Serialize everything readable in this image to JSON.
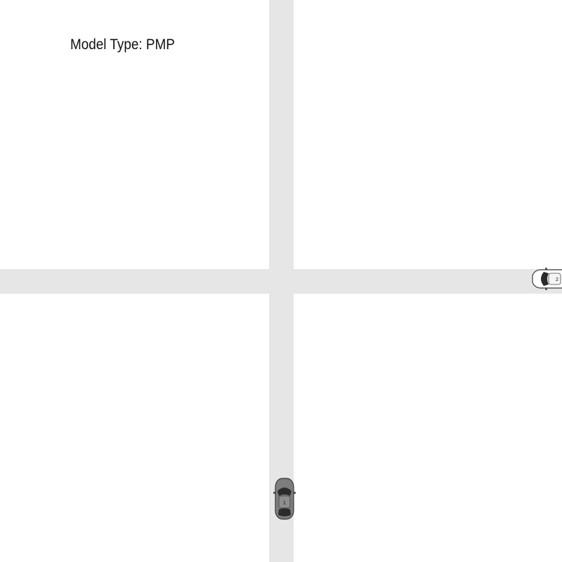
{
  "scene": {
    "model_type_label": "Model Type: PMP",
    "road_color": "#e6e6e6",
    "background_color": "#ffffff"
  },
  "vehicles": [
    {
      "id": "1",
      "label": "1",
      "body_color": "#7d7d7d",
      "heading": "north"
    },
    {
      "id": "2",
      "label": "2",
      "body_color": "#ffffff",
      "heading": "west"
    }
  ]
}
